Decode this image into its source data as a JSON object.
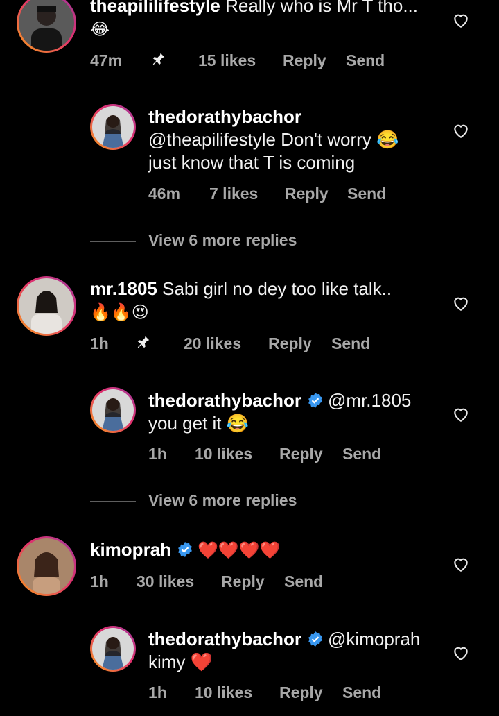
{
  "comments": [
    {
      "username": "theapililifestyle",
      "text": "Really who is Mr T tho...",
      "emoji": "😂",
      "time": "47m",
      "likes": "15 likes",
      "reply": "Reply",
      "send": "Send"
    },
    {
      "username": "thedorathybachor",
      "text_line1": "@theapilifestyle Don't worry 😂",
      "text_line2": "just know that T is coming",
      "time": "46m",
      "likes": "7 likes",
      "reply": "Reply",
      "send": "Send"
    },
    {
      "username": "mr.1805",
      "text": "Sabi girl no dey too like talk..",
      "emoji": "🔥🔥😍",
      "time": "1h",
      "likes": "20 likes",
      "reply": "Reply",
      "send": "Send"
    },
    {
      "username": "thedorathybachor",
      "mention": "@mr.1805",
      "text_line2": "you get it 😂",
      "time": "1h",
      "likes": "10 likes",
      "reply": "Reply",
      "send": "Send"
    },
    {
      "username": "kimoprah",
      "emoji": "❤️❤️❤️❤️",
      "time": "1h",
      "likes": "30 likes",
      "reply": "Reply",
      "send": "Send"
    },
    {
      "username": "thedorathybachor",
      "mention": "@kimoprah",
      "text_line2": "kimy ❤️",
      "time": "1h",
      "likes": "10 likes",
      "reply": "Reply",
      "send": "Send"
    }
  ],
  "view_more_1": "View 6 more replies",
  "view_more_2": "View 6 more replies",
  "colors": {
    "background": "#000000",
    "secondary_text": "#a8a8a8",
    "verified": "#3897f0"
  }
}
